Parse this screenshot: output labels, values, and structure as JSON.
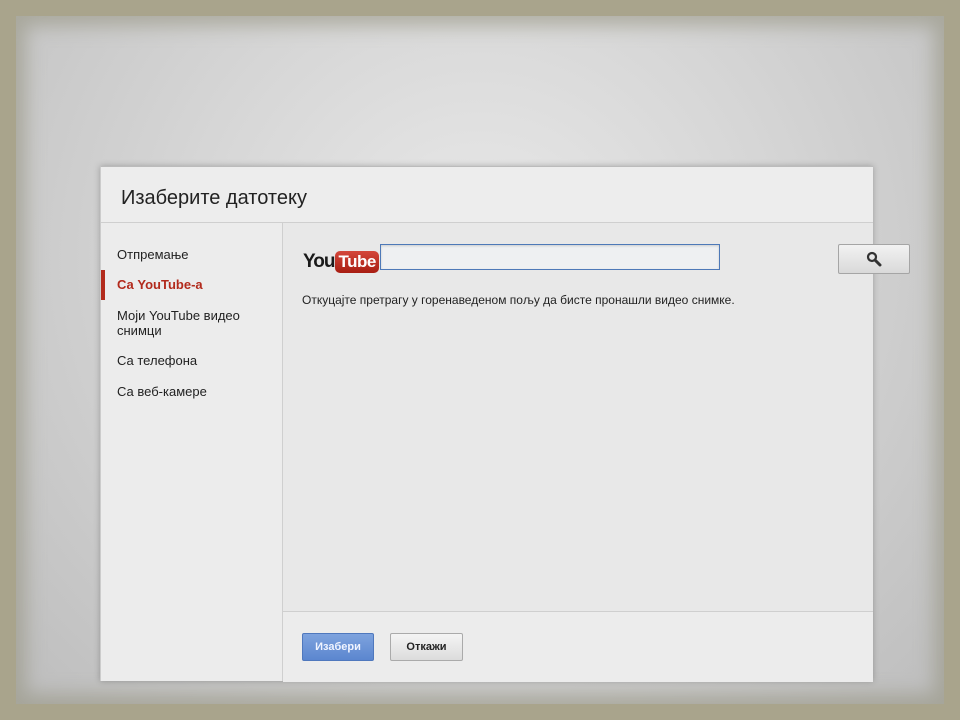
{
  "dialog": {
    "title": "Изаберите датотеку"
  },
  "sidebar": {
    "items": [
      {
        "label": "Отпремање",
        "active": false
      },
      {
        "label": "Са YouTube-а",
        "active": true
      },
      {
        "label": "Моји YouTube видео снимци",
        "active": false
      },
      {
        "label": "Са телефона",
        "active": false
      },
      {
        "label": "Са веб-камере",
        "active": false
      }
    ]
  },
  "main": {
    "logo": {
      "you": "You",
      "tube": "Tube"
    },
    "search": {
      "value": "",
      "button_icon": "search-icon"
    },
    "hint": "Откуцајте претрагу у горенаведеном пољу да бисте пронашли видео снимке."
  },
  "footer": {
    "select_label": "Изабери",
    "cancel_label": "Откажи"
  },
  "colors": {
    "accent": "#b22a1c",
    "primary_button": "#5b86cf",
    "input_border": "#4d79b8"
  }
}
